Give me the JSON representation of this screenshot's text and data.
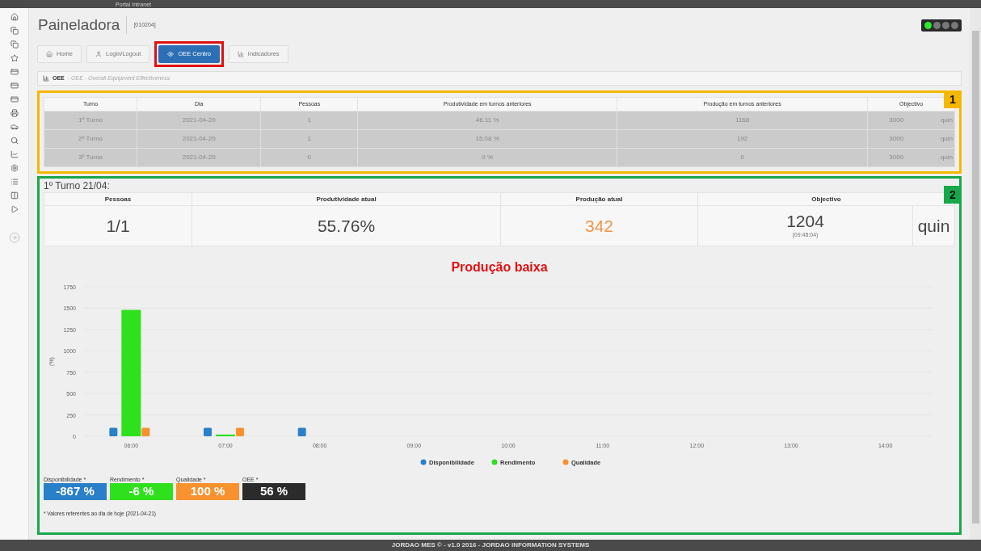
{
  "window": {
    "title": "Portal Intranet"
  },
  "header": {
    "title": "Paineladora",
    "code": "[010204]",
    "lights": [
      {
        "on": true
      },
      {
        "on": false
      },
      {
        "on": false
      },
      {
        "on": false
      }
    ]
  },
  "nav_tabs": [
    {
      "label": "Home",
      "selected": false
    },
    {
      "label": "Login/Logout",
      "selected": false
    },
    {
      "label": "OEE Centro",
      "selected": true
    },
    {
      "label": "Indicadores",
      "selected": false
    }
  ],
  "panel": {
    "title": "OEE",
    "subtitle": "- OEE - Overall Equipment Effectiveness"
  },
  "previous_shifts": {
    "marker": "1",
    "columns": [
      "Turno",
      "Dia",
      "Pessoas",
      "Produtividade em turnos anteriores",
      "Produção em turnos anteriores",
      "Objectivo"
    ],
    "rows": [
      {
        "cells": [
          "1º Turno",
          "2021-04-20",
          "1",
          "46.11 %",
          "1168"
        ],
        "objective": "3000",
        "unit": "quin"
      },
      {
        "cells": [
          "2º Turno",
          "2021-04-20",
          "1",
          "15.08 %",
          "192"
        ],
        "objective": "3000",
        "unit": "quin"
      },
      {
        "cells": [
          "3º Turno",
          "2021-04-20",
          "0",
          "0 %",
          "0"
        ],
        "objective": "3000",
        "unit": "quin"
      }
    ]
  },
  "current_shift": {
    "marker": "2",
    "title": "1º Turno 21/04:",
    "columns": [
      "Pessoas",
      "Produtividade atual",
      "Produção atual",
      "Objectivo"
    ],
    "people": "1/1",
    "productivity": "55.76%",
    "production": "342",
    "objective": "1204",
    "objective_time": "(09:48:04)",
    "unit": "quin",
    "status": "Produção baixa",
    "chart_data": {
      "type": "bar",
      "ylabel": "(%)",
      "categories": [
        "06:00",
        "07:00",
        "08:00",
        "09:00",
        "10:00",
        "11:00",
        "12:00",
        "13:00",
        "14:00"
      ],
      "series": [
        {
          "name": "Disponibilidade",
          "color": "#2a7fc9",
          "values": [
            100,
            100,
            100,
            null,
            null,
            null,
            null,
            null,
            null
          ]
        },
        {
          "name": "Rendimento",
          "color": "#2fe01d",
          "values": [
            1480,
            20,
            null,
            null,
            null,
            null,
            null,
            null,
            null
          ]
        },
        {
          "name": "Qualidade",
          "color": "#f7922e",
          "values": [
            100,
            100,
            null,
            null,
            null,
            null,
            null,
            null,
            null
          ]
        }
      ],
      "ylim": [
        0,
        1750
      ],
      "yticks": [
        0,
        250,
        500,
        750,
        1000,
        1250,
        1500,
        1750
      ],
      "grid": true,
      "legend": "bottom"
    },
    "kpis": [
      {
        "label": "Disponibilidade *",
        "value": "-867 %",
        "color": "#2a7fc9"
      },
      {
        "label": "Rendimento *",
        "value": "-6 %",
        "color": "#2fe01d"
      },
      {
        "label": "Qualidade *",
        "value": "100 %",
        "color": "#f7922e"
      },
      {
        "label": "OEE *",
        "value": "56 %",
        "color": "#2b2b2b"
      }
    ],
    "footnote": "* Valores referentes ao dia de hoje (2021-04-21)"
  },
  "footer": "JORDAO MES © - v1.0 2016 - JORDAO INFORMATION SYSTEMS"
}
